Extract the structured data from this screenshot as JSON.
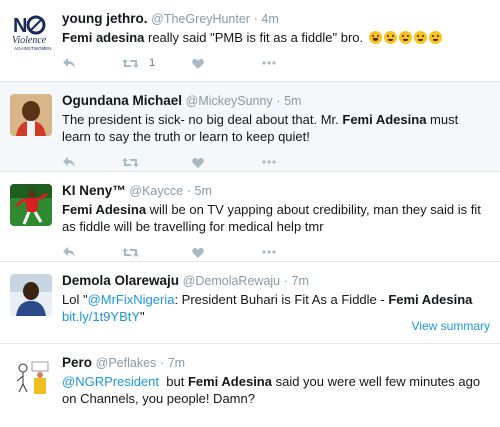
{
  "tweets": [
    {
      "name": "young jethro.",
      "handle": "@TheGreyHunter",
      "dot": "·",
      "time": "4m",
      "text_bold": "Femi adesina",
      "text_rest": " really said \"PMB  is fit as a fiddle\" bro. ",
      "emojis": [
        "laughing-tears",
        "crying-face",
        "crying-face",
        "crying-face",
        "crying-face"
      ],
      "retweet_count": "1",
      "avatar_icon": "no-violence-logo",
      "avatar_text": "NO Violence",
      "avatar_subtext": "AGAINST WOMEN"
    },
    {
      "name": "Ogundana Michael",
      "handle": "@MickeySunny",
      "dot": "·",
      "time": "5m",
      "text_before": "The president is sick- no big deal about that. Mr. ",
      "text_bold": "Femi Adesina",
      "text_after": " must learn to say the truth or learn to keep quiet!",
      "avatar_icon": "profile-photo"
    },
    {
      "name": "KI Neny™",
      "handle": "@Kaycce",
      "dot": "·",
      "time": "5m",
      "text_bold": "Femi Adesina",
      "text_rest": " will be on TV yapping about credibility, man they said is fit as fiddle will be travelling for medical help tmr",
      "avatar_icon": "footballer-photo"
    },
    {
      "name": "Demola Olarewaju",
      "handle": "@DemolaRewaju",
      "dot": "·",
      "time": "7m",
      "text_before": "Lol \"",
      "mention": "@MrFixNigeria",
      "text_mid": ": President Buhari is Fit As a Fiddle - ",
      "text_bold": "Femi Adesina",
      "text_space": " ",
      "link": "bit.ly/1t9YBtY",
      "text_end": "\"",
      "summary": "View summary",
      "avatar_icon": "profile-photo"
    },
    {
      "name": "Pero",
      "handle": "@Peflakes",
      "dot": "·",
      "time": "7m",
      "mention": "@NGRPresident",
      "text_mid": "  but ",
      "text_bold": "Femi Adesina",
      "text_rest": " said you were well few minutes ago on Channels, you people! Damn?",
      "avatar_icon": "cartoon-avatar"
    }
  ],
  "colors": {
    "link": "#1b95e0",
    "muted": "#8899a6",
    "icon": "#aab8c2",
    "highlight": "#f5f8fa"
  }
}
